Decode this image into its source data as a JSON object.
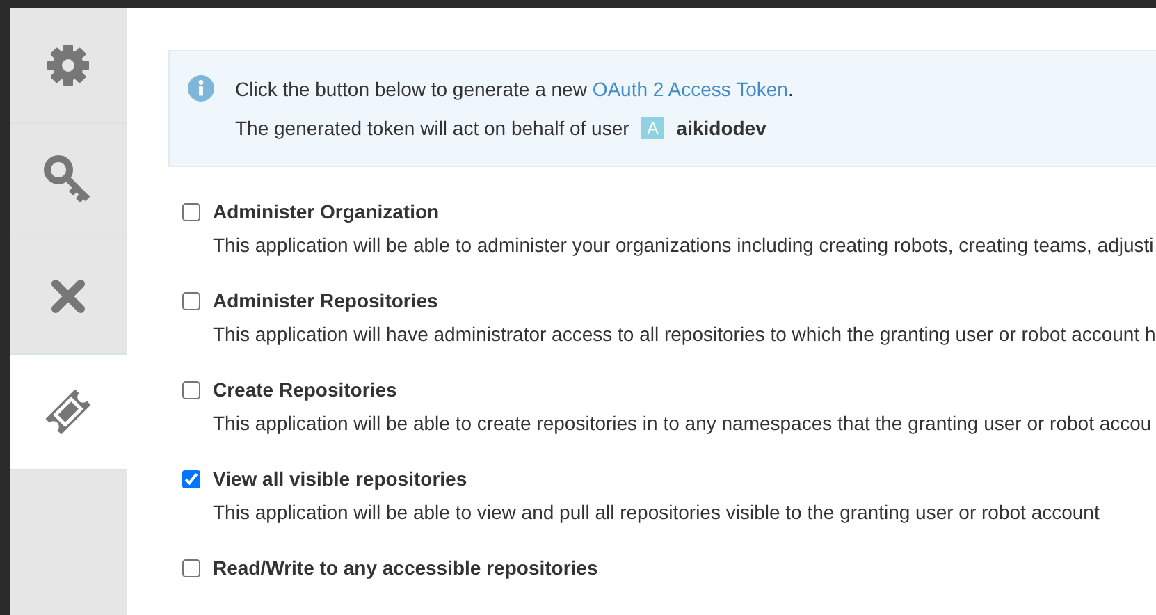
{
  "sidebar": {
    "tabs": [
      {
        "kind": "gear",
        "selected": false
      },
      {
        "kind": "key",
        "selected": false
      },
      {
        "kind": "close",
        "selected": false
      },
      {
        "kind": "ticket",
        "selected": true
      }
    ]
  },
  "info": {
    "line_1": "Click the button below to generate a new ",
    "link": "OAuth 2 Access Token",
    "line_1_end": ".",
    "line_2": "The generated token will act on behalf of user",
    "avatar_letter": "A",
    "username": "aikidodev"
  },
  "permissions": [
    {
      "title": "Administer Organization",
      "description": "This application will be able to administer your organizations including creating robots, creating teams, adjusti",
      "checked": false
    },
    {
      "title": "Administer Repositories",
      "description": "This application will have administrator access to all repositories to which the granting user or robot account h",
      "checked": false
    },
    {
      "title": "Create Repositories",
      "description": "This application will be able to create repositories in to any namespaces that the granting user or robot accou",
      "checked": false
    },
    {
      "title": "View all visible repositories",
      "description": "This application will be able to view and pull all repositories visible to the granting user or robot account",
      "checked": true
    },
    {
      "title": "Read/Write to any accessible repositories",
      "checked": false
    }
  ]
}
